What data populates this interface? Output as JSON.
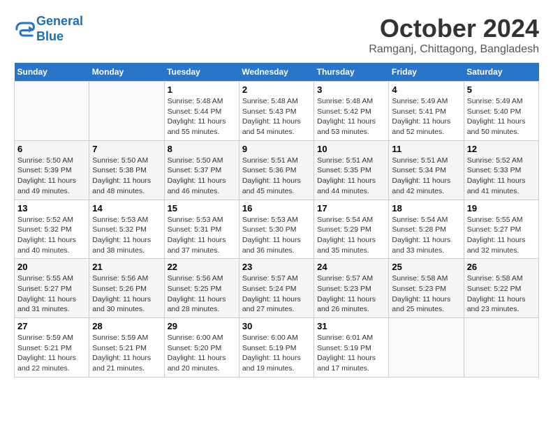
{
  "header": {
    "logo_line1": "General",
    "logo_line2": "Blue",
    "month_title": "October 2024",
    "subtitle": "Ramganj, Chittagong, Bangladesh"
  },
  "weekdays": [
    "Sunday",
    "Monday",
    "Tuesday",
    "Wednesday",
    "Thursday",
    "Friday",
    "Saturday"
  ],
  "weeks": [
    [
      {
        "day": "",
        "info": ""
      },
      {
        "day": "",
        "info": ""
      },
      {
        "day": "1",
        "sunrise": "5:48 AM",
        "sunset": "5:44 PM",
        "daylight": "11 hours and 55 minutes."
      },
      {
        "day": "2",
        "sunrise": "5:48 AM",
        "sunset": "5:43 PM",
        "daylight": "11 hours and 54 minutes."
      },
      {
        "day": "3",
        "sunrise": "5:48 AM",
        "sunset": "5:42 PM",
        "daylight": "11 hours and 53 minutes."
      },
      {
        "day": "4",
        "sunrise": "5:49 AM",
        "sunset": "5:41 PM",
        "daylight": "11 hours and 52 minutes."
      },
      {
        "day": "5",
        "sunrise": "5:49 AM",
        "sunset": "5:40 PM",
        "daylight": "11 hours and 50 minutes."
      }
    ],
    [
      {
        "day": "6",
        "sunrise": "5:50 AM",
        "sunset": "5:39 PM",
        "daylight": "11 hours and 49 minutes."
      },
      {
        "day": "7",
        "sunrise": "5:50 AM",
        "sunset": "5:38 PM",
        "daylight": "11 hours and 48 minutes."
      },
      {
        "day": "8",
        "sunrise": "5:50 AM",
        "sunset": "5:37 PM",
        "daylight": "11 hours and 46 minutes."
      },
      {
        "day": "9",
        "sunrise": "5:51 AM",
        "sunset": "5:36 PM",
        "daylight": "11 hours and 45 minutes."
      },
      {
        "day": "10",
        "sunrise": "5:51 AM",
        "sunset": "5:35 PM",
        "daylight": "11 hours and 44 minutes."
      },
      {
        "day": "11",
        "sunrise": "5:51 AM",
        "sunset": "5:34 PM",
        "daylight": "11 hours and 42 minutes."
      },
      {
        "day": "12",
        "sunrise": "5:52 AM",
        "sunset": "5:33 PM",
        "daylight": "11 hours and 41 minutes."
      }
    ],
    [
      {
        "day": "13",
        "sunrise": "5:52 AM",
        "sunset": "5:32 PM",
        "daylight": "11 hours and 40 minutes."
      },
      {
        "day": "14",
        "sunrise": "5:53 AM",
        "sunset": "5:32 PM",
        "daylight": "11 hours and 38 minutes."
      },
      {
        "day": "15",
        "sunrise": "5:53 AM",
        "sunset": "5:31 PM",
        "daylight": "11 hours and 37 minutes."
      },
      {
        "day": "16",
        "sunrise": "5:53 AM",
        "sunset": "5:30 PM",
        "daylight": "11 hours and 36 minutes."
      },
      {
        "day": "17",
        "sunrise": "5:54 AM",
        "sunset": "5:29 PM",
        "daylight": "11 hours and 35 minutes."
      },
      {
        "day": "18",
        "sunrise": "5:54 AM",
        "sunset": "5:28 PM",
        "daylight": "11 hours and 33 minutes."
      },
      {
        "day": "19",
        "sunrise": "5:55 AM",
        "sunset": "5:27 PM",
        "daylight": "11 hours and 32 minutes."
      }
    ],
    [
      {
        "day": "20",
        "sunrise": "5:55 AM",
        "sunset": "5:27 PM",
        "daylight": "11 hours and 31 minutes."
      },
      {
        "day": "21",
        "sunrise": "5:56 AM",
        "sunset": "5:26 PM",
        "daylight": "11 hours and 30 minutes."
      },
      {
        "day": "22",
        "sunrise": "5:56 AM",
        "sunset": "5:25 PM",
        "daylight": "11 hours and 28 minutes."
      },
      {
        "day": "23",
        "sunrise": "5:57 AM",
        "sunset": "5:24 PM",
        "daylight": "11 hours and 27 minutes."
      },
      {
        "day": "24",
        "sunrise": "5:57 AM",
        "sunset": "5:23 PM",
        "daylight": "11 hours and 26 minutes."
      },
      {
        "day": "25",
        "sunrise": "5:58 AM",
        "sunset": "5:23 PM",
        "daylight": "11 hours and 25 minutes."
      },
      {
        "day": "26",
        "sunrise": "5:58 AM",
        "sunset": "5:22 PM",
        "daylight": "11 hours and 23 minutes."
      }
    ],
    [
      {
        "day": "27",
        "sunrise": "5:59 AM",
        "sunset": "5:21 PM",
        "daylight": "11 hours and 22 minutes."
      },
      {
        "day": "28",
        "sunrise": "5:59 AM",
        "sunset": "5:21 PM",
        "daylight": "11 hours and 21 minutes."
      },
      {
        "day": "29",
        "sunrise": "6:00 AM",
        "sunset": "5:20 PM",
        "daylight": "11 hours and 20 minutes."
      },
      {
        "day": "30",
        "sunrise": "6:00 AM",
        "sunset": "5:19 PM",
        "daylight": "11 hours and 19 minutes."
      },
      {
        "day": "31",
        "sunrise": "6:01 AM",
        "sunset": "5:19 PM",
        "daylight": "11 hours and 17 minutes."
      },
      {
        "day": "",
        "info": ""
      },
      {
        "day": "",
        "info": ""
      }
    ]
  ],
  "labels": {
    "sunrise": "Sunrise:",
    "sunset": "Sunset:",
    "daylight": "Daylight:"
  }
}
